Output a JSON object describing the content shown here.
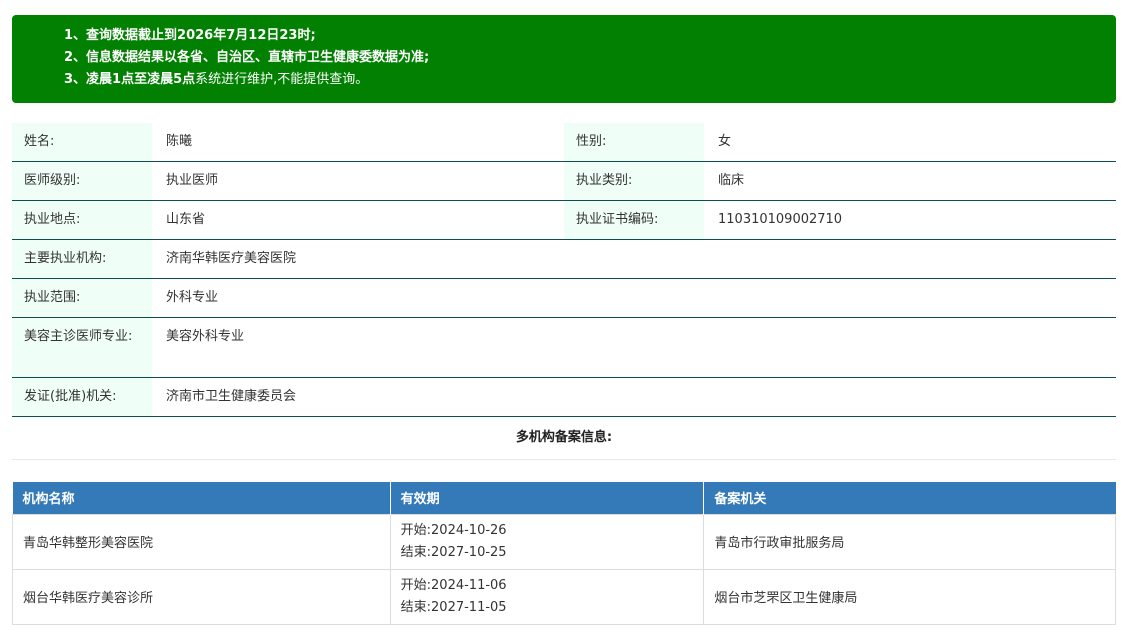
{
  "notice": {
    "line1": {
      "prefix": "1、查询数据截止到",
      "bold": "2026年7月12日23时",
      "suffix": ";"
    },
    "line2": {
      "text": "2、信息数据结果以各省、自治区、直辖市卫生健康委数据为准;"
    },
    "line3": {
      "prefix": "3、",
      "bold": "凌晨1点至凌晨5点",
      "suffix": "系统进行维护,不能提供查询。"
    }
  },
  "doctor": {
    "name_label": "姓名:",
    "name": "陈曦",
    "gender_label": "性别:",
    "gender": "女",
    "level_label": "医师级别:",
    "level": "执业医师",
    "category_label": "执业类别:",
    "category": "临床",
    "location_label": "执业地点:",
    "location": "山东省",
    "cert_label": "执业证书编码:",
    "cert": "110310109002710",
    "institution_label": "主要执业机构:",
    "institution": "济南华韩医疗美容医院",
    "scope_label": "执业范围:",
    "scope": "外科专业",
    "cosmetic_label": "美容主诊医师专业:",
    "cosmetic": "美容外科专业",
    "issuer_label": "发证(批准)机关:",
    "issuer": "济南市卫生健康委员会"
  },
  "multi_title": "多机构备案信息:",
  "orgs": {
    "headers": {
      "name": "机构名称",
      "validity": "有效期",
      "authority": "备案机关"
    },
    "rows": [
      {
        "name": "青岛华韩整形美容医院",
        "start": "开始:2024-10-26",
        "end": "结束:2027-10-25",
        "authority": "青岛市行政审批服务局"
      },
      {
        "name": "烟台华韩医疗美容诊所",
        "start": "开始:2024-11-06",
        "end": "结束:2027-11-05",
        "authority": "烟台市芝罘区卫生健康局"
      }
    ]
  }
}
